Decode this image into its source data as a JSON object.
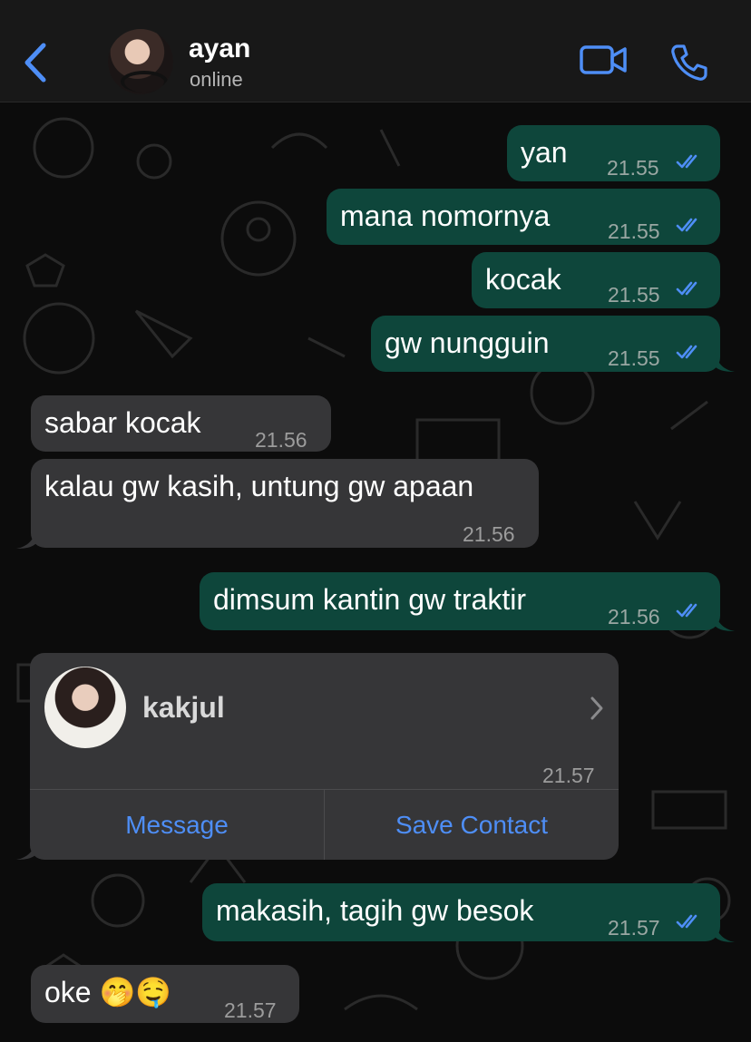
{
  "header": {
    "contact_name": "ayan",
    "status": "online",
    "back_icon": "chevron-left-icon",
    "video_icon": "video-camera-icon",
    "phone_icon": "phone-icon",
    "accent_color": "#4e8ef6"
  },
  "messages": [
    {
      "text": "yan",
      "time": "21.55",
      "direction": "out",
      "read": true
    },
    {
      "text": "mana nomornya",
      "time": "21.55",
      "direction": "out",
      "read": true
    },
    {
      "text": "kocak",
      "time": "21.55",
      "direction": "out",
      "read": true
    },
    {
      "text": "gw nungguin",
      "time": "21.55",
      "direction": "out",
      "read": true
    },
    {
      "text": "sabar kocak",
      "time": "21.56",
      "direction": "in"
    },
    {
      "text": "kalau gw kasih, untung gw apaan",
      "time": "21.56",
      "direction": "in"
    },
    {
      "text": "dimsum kantin gw traktir",
      "time": "21.56",
      "direction": "out",
      "read": true
    },
    {
      "text": "makasih, tagih gw besok",
      "time": "21.57",
      "direction": "out",
      "read": true
    },
    {
      "text": "oke 🤭🤤",
      "time": "21.57",
      "direction": "in"
    }
  ],
  "contact_card": {
    "name": "kakjul",
    "time": "21.57",
    "message_button": "Message",
    "save_button": "Save Contact"
  },
  "colors": {
    "outgoing_bubble": "#0e463b",
    "incoming_bubble": "#363638",
    "tick_color": "#4e8ef6"
  }
}
